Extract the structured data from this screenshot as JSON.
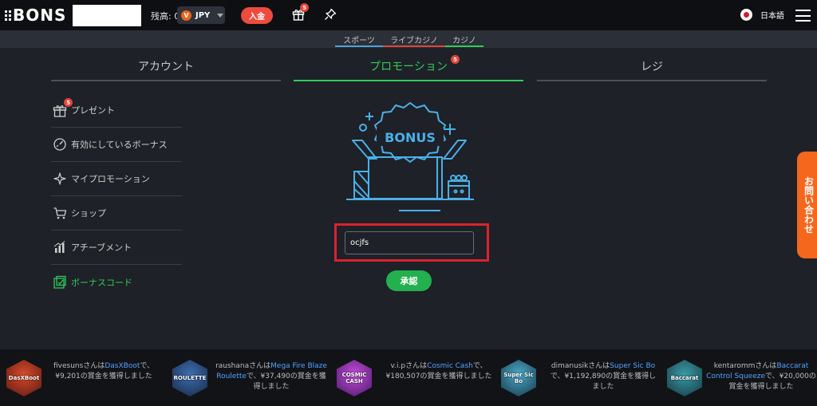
{
  "header": {
    "logo": "BONS",
    "balance_label": "残高: 0",
    "currency_coin": "V",
    "currency": "JPY",
    "deposit": "入金",
    "gift_badge": "5",
    "language": "日本語"
  },
  "categories": [
    {
      "label": "スポーツ",
      "color": "#4aa3df"
    },
    {
      "label": "ライブカジノ",
      "color": "#e5433a"
    },
    {
      "label": "カジノ",
      "color": "#2ecc5b"
    }
  ],
  "tabs": [
    {
      "label": "アカウント"
    },
    {
      "label": "プロモーション",
      "badge": "5",
      "active": true
    },
    {
      "label": "レジ"
    }
  ],
  "sidebar": {
    "items": [
      {
        "label": "プレゼント",
        "icon": "gift-icon",
        "badge": "5"
      },
      {
        "label": "有効にしているボーナス",
        "icon": "gauge-icon"
      },
      {
        "label": "マイプロモーション",
        "icon": "sparkle-icon"
      },
      {
        "label": "ショップ",
        "icon": "cart-icon"
      },
      {
        "label": "アチーブメント",
        "icon": "chart-icon"
      },
      {
        "label": "ボーナスコード",
        "icon": "bonus-code-icon",
        "active": true
      }
    ]
  },
  "promo": {
    "art_text": "BONUS",
    "code_value": "ocjfs",
    "approve": "承認"
  },
  "contact": "お問い合わせ",
  "ticker": [
    {
      "game_label": "DasXBoot",
      "pre": "fivesunsさんは",
      "game": "DasXBoot",
      "post": "で、¥9,201の賞金を獲得しました"
    },
    {
      "game_label": "ROULETTE",
      "pre": "raushanaさんは",
      "game": "Mega Fire Blaze Roulette",
      "post": "で、¥37,490の賞金を獲得しました"
    },
    {
      "game_label": "COSMIC CASH",
      "pre": "v.i.pさんは",
      "game": "Cosmic Cash",
      "post": "で、¥180,507の賞金を獲得しました"
    },
    {
      "game_label": "Super Sic Bo",
      "pre": "dimanusikさんは",
      "game": "Super Sic Bo",
      "post": "で、¥1,192,890の賞金を獲得しました"
    },
    {
      "game_label": "Baccarat",
      "pre": "kentarommさんは",
      "game": "Baccarat Control Squeeze",
      "post": "で、¥20,000の賞金を獲得しました"
    }
  ]
}
